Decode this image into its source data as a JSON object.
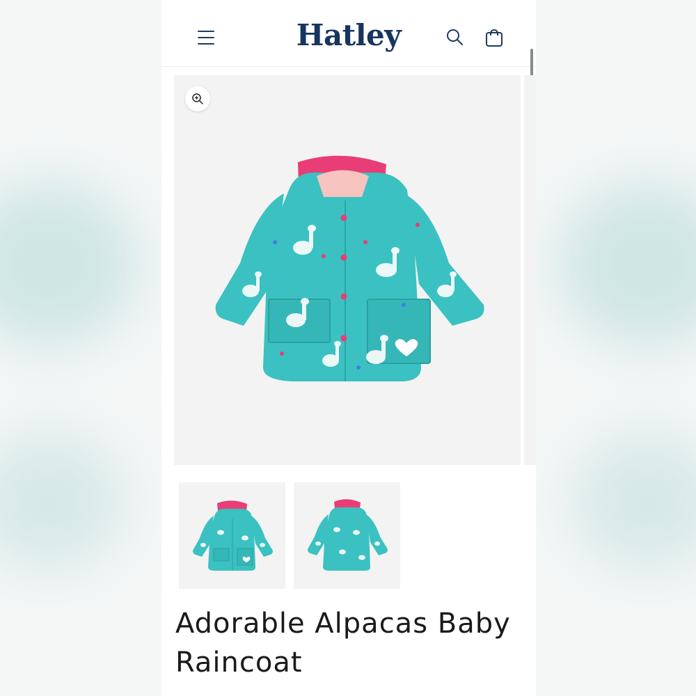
{
  "brand": {
    "logo_text": "Hatley"
  },
  "header": {
    "menu_icon": "hamburger-icon",
    "search_icon": "search-icon",
    "cart_icon": "cart-bag-icon"
  },
  "gallery": {
    "zoom_icon": "zoom-in-icon",
    "thumbnails": [
      {
        "icon": "raincoat-front-image"
      },
      {
        "icon": "raincoat-back-image"
      }
    ]
  },
  "product": {
    "title": "Adorable Alpacas Baby Raincoat"
  },
  "colors": {
    "brand_navy": "#17355f",
    "coat_teal": "#3bc1c1",
    "lining_pink": "#e83d76"
  }
}
